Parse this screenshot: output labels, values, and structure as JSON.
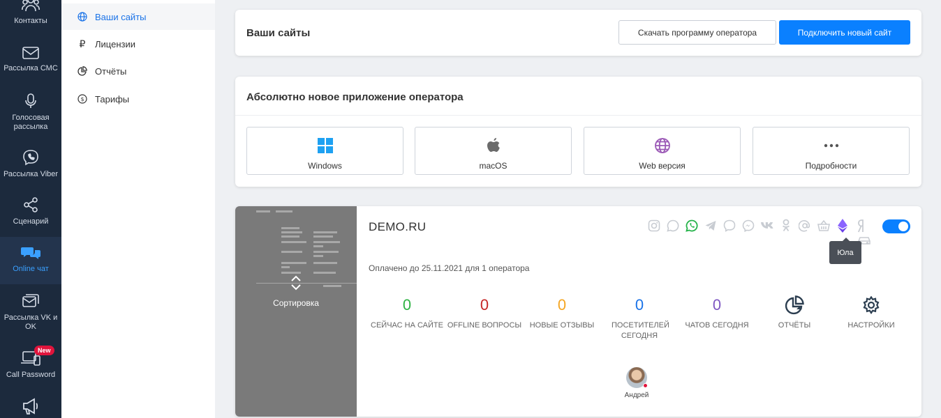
{
  "rail": {
    "items": [
      {
        "label": "Контакты",
        "icon": "contacts-icon"
      },
      {
        "label": "Рассылка СМС",
        "icon": "envelope-icon"
      },
      {
        "label": "Голосовая рассылка",
        "icon": "microphone-icon"
      },
      {
        "label": "Рассылка Viber",
        "icon": "viber-icon"
      },
      {
        "label": "Сценарий",
        "icon": "share-nodes-icon"
      },
      {
        "label": "Online чат",
        "icon": "chat-bubbles-icon"
      },
      {
        "label": "Рассылка VK и OK",
        "icon": "mail-stack-icon"
      },
      {
        "label": "Call Password",
        "icon": "laptop-phone-icon",
        "badge": "New"
      },
      {
        "label": "",
        "icon": "megaphone-icon"
      }
    ]
  },
  "subnav": {
    "items": [
      {
        "label": "Ваши сайты",
        "icon": "globe-icon"
      },
      {
        "label": "Лицензии",
        "icon": "ruble-icon"
      },
      {
        "label": "Отчёты",
        "icon": "pie-chart-icon"
      },
      {
        "label": "Тарифы",
        "icon": "dollar-circle-icon"
      }
    ]
  },
  "header": {
    "title": "Ваши сайты",
    "download_label": "Скачать программу оператора",
    "connect_label": "Подключить новый сайт"
  },
  "app_card": {
    "title": "Абсолютно новое приложение оператора",
    "tiles": [
      {
        "label": "Windows",
        "icon": "windows-icon"
      },
      {
        "label": "macOS",
        "icon": "apple-icon"
      },
      {
        "label": "Web версия",
        "icon": "globe-icon"
      },
      {
        "label": "Подробности",
        "icon": "more-dots-icon"
      }
    ]
  },
  "site": {
    "name": "DEMO.RU",
    "paid_text": "Оплачено до 25.11.2021 для 1 оператора",
    "preview_label": "Сортировка",
    "tooltip": "Юла",
    "stats": [
      {
        "value": "0",
        "label": "СЕЙЧАС НА САЙТЕ",
        "color": "#2fb344"
      },
      {
        "value": "0",
        "label": "OFFLINE ВОПРОСЫ",
        "color": "#c62828"
      },
      {
        "value": "0",
        "label": "НОВЫЕ ОТЗЫВЫ",
        "color": "#f5a623"
      },
      {
        "value": "0",
        "label": "ПОСЕТИТЕЛЕЙ СЕГОДНЯ",
        "color": "#1a73e8"
      },
      {
        "value": "0",
        "label": "ЧАТОВ СЕГОДНЯ",
        "color": "#7e57c2"
      }
    ],
    "actions": [
      {
        "label": "ОТЧЁТЫ",
        "icon": "pie-chart-icon"
      },
      {
        "label": "НАСТРОЙКИ",
        "icon": "gear-icon"
      }
    ],
    "operator": {
      "name": "Андрей"
    }
  },
  "colors": {
    "rail_bg": "#1c2a3d",
    "accent": "#0a80ff",
    "active_link": "#1a73e8"
  }
}
